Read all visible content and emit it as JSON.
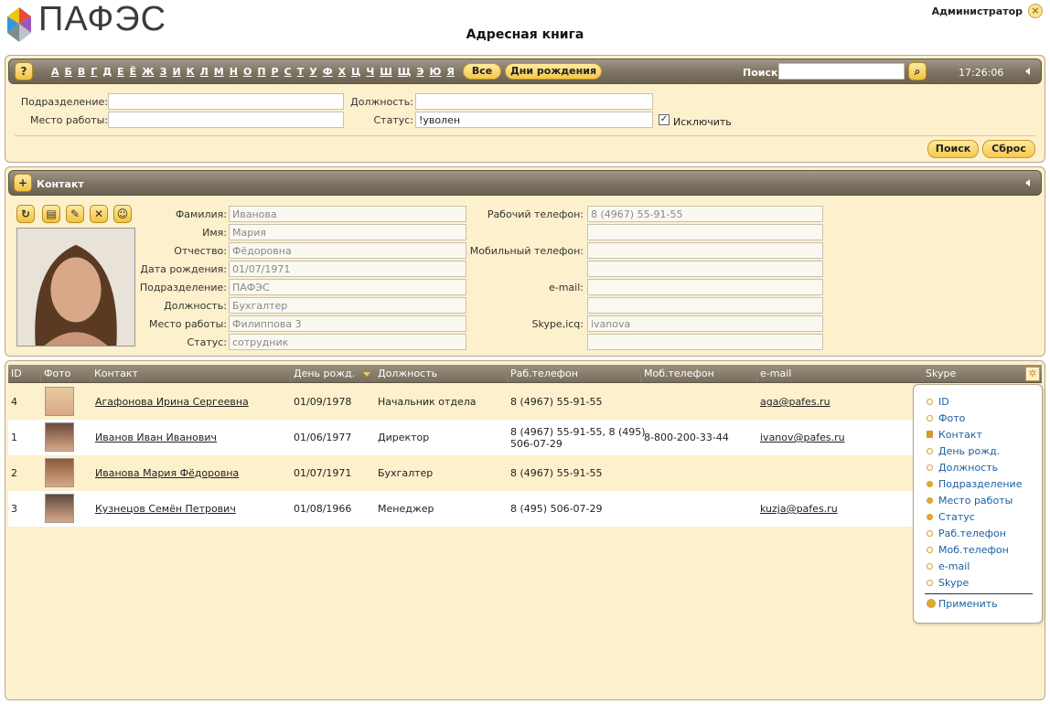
{
  "app": {
    "logo_text": "ПАФЭС",
    "title": "Адресная книга",
    "user": "Администратор",
    "logout_symbol": "×"
  },
  "toolbar": {
    "help": "?",
    "letters": [
      "А",
      "Б",
      "В",
      "Г",
      "Д",
      "Е",
      "Ё",
      "Ж",
      "З",
      "И",
      "К",
      "Л",
      "М",
      "Н",
      "О",
      "П",
      "Р",
      "С",
      "Т",
      "У",
      "Ф",
      "Х",
      "Ц",
      "Ч",
      "Ш",
      "Щ",
      "Э",
      "Ю",
      "Я"
    ],
    "all": "Все",
    "birthdays": "Дни рождения",
    "search_label": "Поиск:",
    "search_value": "",
    "time": "17:26:06"
  },
  "filter": {
    "dept_label": "Подразделение:",
    "dept_value": "",
    "work_label": "Место работы:",
    "work_value": "",
    "position_label": "Должность:",
    "position_value": "",
    "status_label": "Статус:",
    "status_value": "!уволен",
    "exclude_label": "Исключить",
    "exclude_checked": true,
    "search_btn": "Поиск",
    "reset_btn": "Сброс"
  },
  "contact": {
    "header": "Контакт",
    "add_icon": "+",
    "labels": {
      "last": "Фамилия:",
      "first": "Имя:",
      "middle": "Отчество:",
      "birth": "Дата рождения:",
      "dept": "Подразделение:",
      "position": "Должность:",
      "work": "Место работы:",
      "status": "Статус:",
      "work_phone": "Рабочий телефон:",
      "mobile": "Мобильный телефон:",
      "email": "e-mail:",
      "skype": "Skype,icq:"
    },
    "values": {
      "last": "Иванова",
      "first": "Мария",
      "middle": "Фёдоровна",
      "birth": "01/07/1971",
      "dept": "ПАФЭС",
      "position": "Бухгалтер",
      "work": "Филиппова 3",
      "status": "сотрудник",
      "work_phone": "8 (4967) 55-91-55",
      "mobile": "",
      "email": "",
      "skype": "ivanova"
    }
  },
  "table": {
    "headers": {
      "id": "ID",
      "photo": "Фото",
      "contact": "Контакт",
      "birthday": "День рожд.",
      "position": "Должность",
      "work_phone": "Раб.телефон",
      "mobile": "Моб.телефон",
      "email": "e-mail",
      "skype": "Skype"
    },
    "rows": [
      {
        "id": "4",
        "name": "Агафонова Ирина Сергеевна",
        "birthday": "01/09/1978",
        "position": "Начальник отдела",
        "phone": "8 (4967) 55-91-55",
        "phone2": "",
        "mobile": "",
        "email": "aga@pafes.ru"
      },
      {
        "id": "1",
        "name": "Иванов Иван Иванович",
        "birthday": "01/06/1977",
        "position": "Директор",
        "phone": "8 (4967) 55-91-55, 8 (495)",
        "phone2": "506-07-29",
        "mobile": "8-800-200-33-44",
        "email": "ivanov@pafes.ru"
      },
      {
        "id": "2",
        "name": "Иванова Мария Фёдоровна",
        "birthday": "01/07/1971",
        "position": "Бухгалтер",
        "phone": "8 (4967) 55-91-55",
        "phone2": "",
        "mobile": "",
        "email": ""
      },
      {
        "id": "3",
        "name": "Кузнецов Семён Петрович",
        "birthday": "01/08/1966",
        "position": "Менеджер",
        "phone": "8 (495) 506-07-29",
        "phone2": "",
        "mobile": "",
        "email": "kuzja@pafes.ru"
      }
    ]
  },
  "columns_menu": {
    "items": [
      "ID",
      "Фото",
      "Контакт",
      "День рожд.",
      "Должность",
      "Подразделение",
      "Место работы",
      "Статус",
      "Раб.телефон",
      "Моб.телефон",
      "e-mail",
      "Skype"
    ],
    "apply": "Применить"
  }
}
